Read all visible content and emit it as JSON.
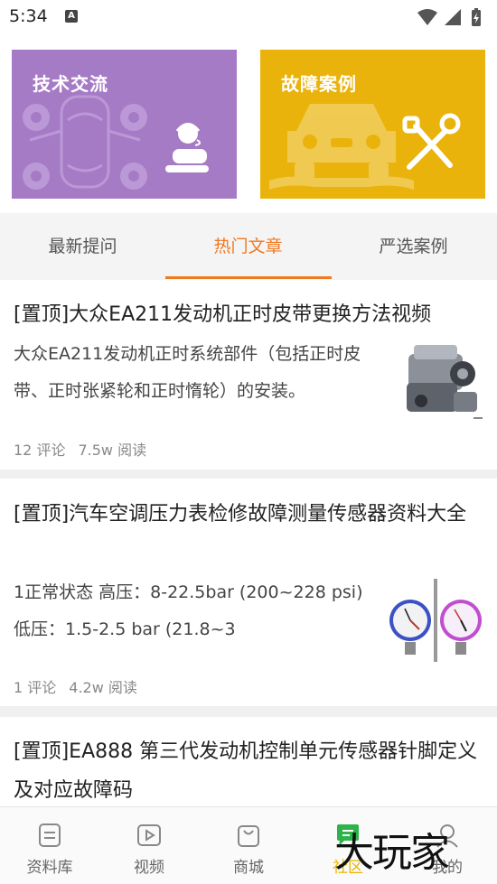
{
  "status_bar": {
    "time": "5:34",
    "notification_letter": "A"
  },
  "banners": [
    {
      "title": "技术交流",
      "color": "#a67bc6"
    },
    {
      "title": "故障案例",
      "color": "#e9b30c"
    }
  ],
  "tabs": [
    {
      "label": "最新提问"
    },
    {
      "label": "热门文章",
      "active": true
    },
    {
      "label": "严选案例"
    }
  ],
  "articles": [
    {
      "title": "[置顶]大众EA211发动机正时皮带更换方法视频",
      "summary": "大众EA211发动机正时系统部件（包括正时皮带、正时张紧轮和正时惰轮）的安装。",
      "comments": "12 评论",
      "reads": "7.5w 阅读"
    },
    {
      "title": "[置顶]汽车空调压力表检修故障测量传感器资料大全",
      "summary": "1正常状态 高压：8-22.5bar (200~228 psi) 低压：1.5-2.5 bar (21.8~3",
      "comments": "1 评论",
      "reads": "4.2w 阅读"
    },
    {
      "title": "[置顶]EA888 第三代发动机控制单元传感器针脚定义及对应故障码"
    }
  ],
  "bottom_nav": [
    {
      "label": "资料库",
      "icon": "document-icon"
    },
    {
      "label": "视频",
      "icon": "video-icon"
    },
    {
      "label": "商城",
      "icon": "shopping-bag-icon"
    },
    {
      "label": "社区",
      "icon": "chat-icon",
      "active": true
    },
    {
      "label": "我的",
      "icon": "profile-icon"
    }
  ],
  "watermark": "大玩家",
  "colors": {
    "accent": "#f07922",
    "active_nav": "#e8b500"
  }
}
